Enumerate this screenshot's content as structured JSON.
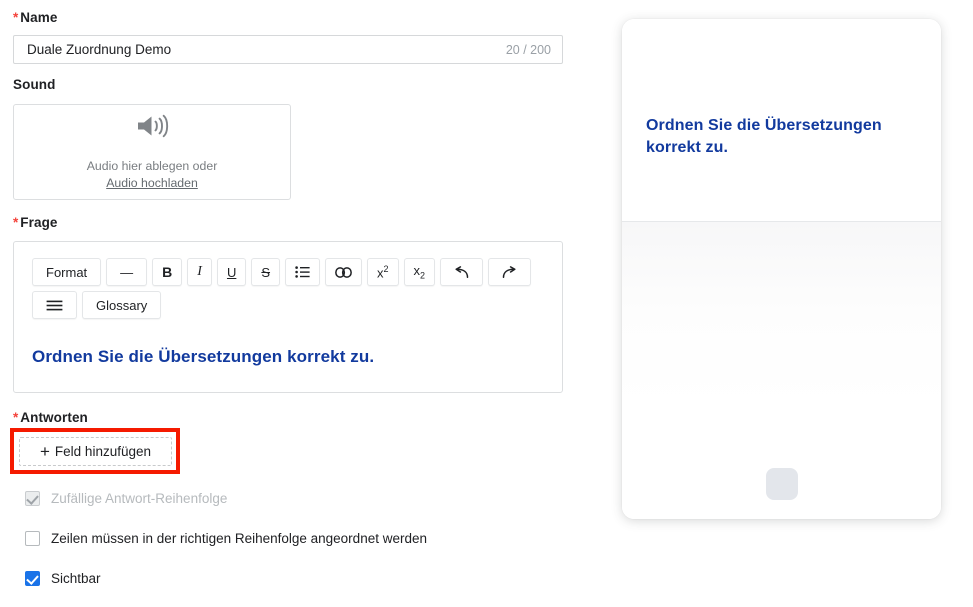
{
  "form": {
    "name_field": {
      "label": "Name",
      "required_marker": "*",
      "value": "Duale Zuordnung Demo",
      "placeholder": "",
      "counter": "20 / 200"
    },
    "sound_field": {
      "label": "Sound",
      "icon": "speaker-icon",
      "drop_text": "Audio hier ablegen oder",
      "upload_link": "Audio hochladen"
    },
    "question_field": {
      "label": "Frage",
      "required_marker": "*",
      "toolbar_row1": [
        {
          "label": "Format",
          "icon": "format-dropdown"
        },
        {
          "label": "—",
          "icon": "horizontal-rule-icon"
        },
        {
          "label": "B",
          "icon": "bold-icon"
        },
        {
          "label": "I",
          "icon": "italic-icon"
        },
        {
          "label": "U",
          "icon": "underline-icon"
        },
        {
          "label": "S",
          "icon": "strikethrough-icon"
        },
        {
          "label": "",
          "icon": "bullet-list-icon"
        },
        {
          "label": "",
          "icon": "link-icon"
        },
        {
          "label": "x2",
          "icon": "superscript-icon"
        }
      ],
      "toolbar_row2": [
        {
          "label": "x2",
          "icon": "subscript-icon"
        },
        {
          "label": "",
          "icon": "undo-icon"
        },
        {
          "label": "",
          "icon": "redo-icon"
        },
        {
          "label": "",
          "icon": "align-icon"
        },
        {
          "label": "Glossary",
          "icon": "glossary-button"
        }
      ],
      "content": "Ordnen Sie die Übersetzungen korrekt zu."
    },
    "answers_field": {
      "label": "Antworten",
      "required_marker": "*",
      "add_button_plus": "+",
      "add_button_label": "Feld hinzufügen",
      "highlight_color": "#f51a00"
    },
    "options": [
      {
        "label": "Zufällige Antwort-Reihenfolge",
        "state": "disabled-checked"
      },
      {
        "label": "Zeilen müssen in der richtigen Reihenfolge angeordnet werden",
        "state": "unchecked"
      },
      {
        "label": "Sichtbar",
        "state": "checked"
      }
    ]
  },
  "preview": {
    "question": "Ordnen Sie die Übersetzungen korrekt zu.",
    "question_color": "#123a9e",
    "action_button_icon": "record-button"
  }
}
